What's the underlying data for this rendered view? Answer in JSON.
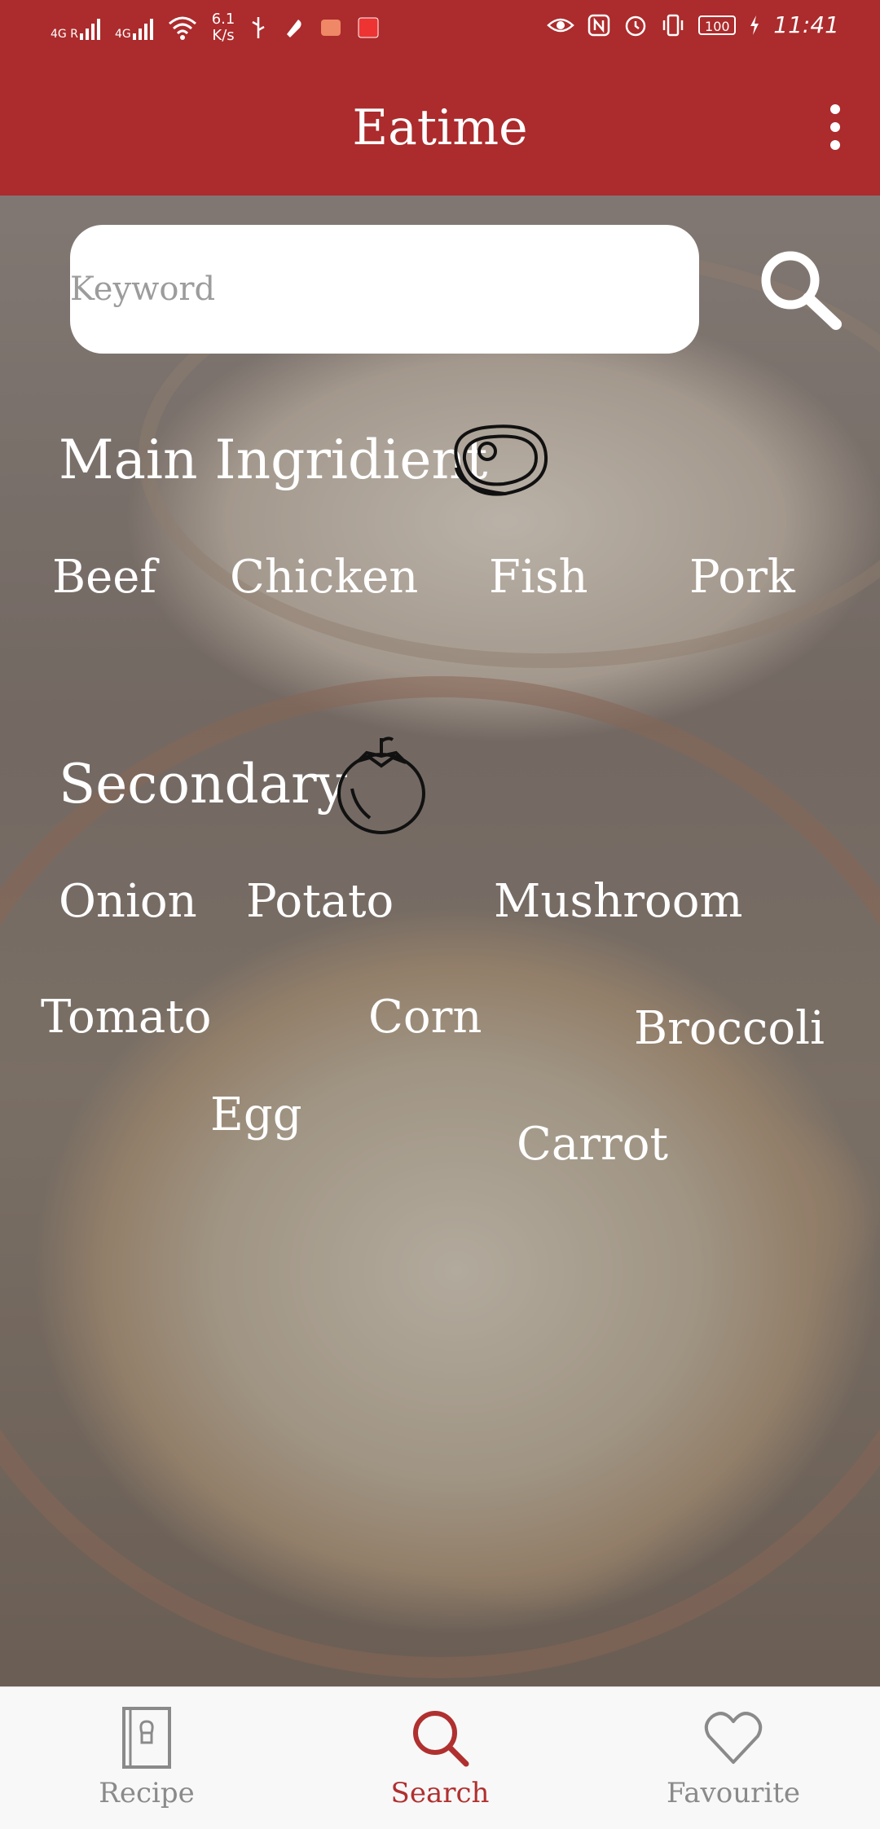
{
  "status_bar": {
    "network_1": "4G R",
    "network_2": "4G",
    "speed_value": "6.1",
    "speed_unit": "K/s",
    "battery": "100",
    "time": "11:41"
  },
  "app_bar": {
    "title": "Eatime",
    "menu_icon": "more-vert-icon"
  },
  "search": {
    "placeholder": "Keyword",
    "value": "",
    "button_icon": "search-icon"
  },
  "main_ingredient": {
    "title": "Main Ingridient",
    "icon": "steak-icon",
    "items": [
      "Beef",
      "Chicken",
      "Fish",
      "Pork"
    ]
  },
  "secondary": {
    "title": "Secondary",
    "icon": "tomato-icon",
    "items": [
      "Onion",
      "Potato",
      "Mushroom",
      "Tomato",
      "Corn",
      "Broccoli",
      "Egg",
      "Carrot"
    ]
  },
  "bottom_nav": {
    "items": [
      {
        "label": "Recipe",
        "icon": "recipe-book-icon",
        "active": false
      },
      {
        "label": "Search",
        "icon": "search-icon",
        "active": true
      },
      {
        "label": "Favourite",
        "icon": "heart-icon",
        "active": false
      }
    ]
  },
  "colors": {
    "primary": "#ac2b2c",
    "active_nav": "#b03030",
    "inactive_nav": "#8a8a8a"
  }
}
